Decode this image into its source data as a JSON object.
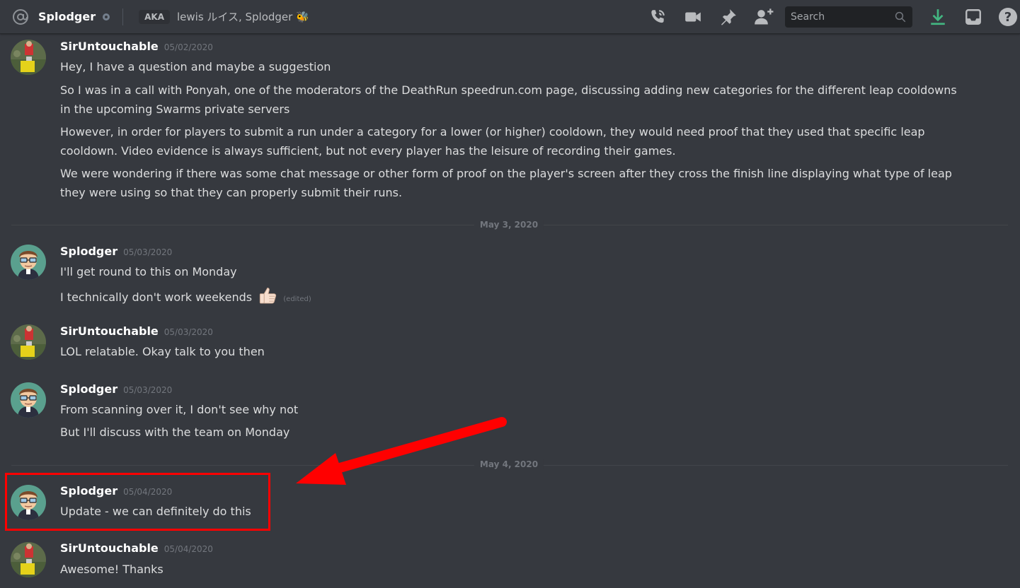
{
  "header": {
    "dm_name": "Splodger",
    "aka_label": "AKA",
    "aka_names": "lewis ルイス, Splodger 🐝",
    "search_placeholder": "Search"
  },
  "users": {
    "sir": "SirUntouchable",
    "splodger": "Splodger"
  },
  "messages": [
    {
      "author": "SirUntouchable",
      "time": "05/02/2020",
      "lines": [
        "Hey, I have a question and maybe a suggestion",
        "So I was in a call with Ponyah, one of the moderators of the DeathRun speedrun.com page, discussing adding new categories for the different leap cooldowns in the upcoming Swarms private servers",
        "However, in order for players to submit a run under a category for a lower (or higher) cooldown, they would need proof that they used that specific leap cooldown.  Video evidence is always sufficient, but not every player has the leisure of recording their games.",
        "We were wondering if there was some chat message or other form of proof on the player's screen after they cross the finish line displaying what type of leap they were using so that they can properly submit their runs."
      ]
    },
    {
      "author": "Splodger",
      "time": "05/03/2020",
      "lines": [
        "I'll get round to this on Monday",
        "I technically don't work weekends"
      ],
      "edited": "(edited)"
    },
    {
      "author": "SirUntouchable",
      "time": "05/03/2020",
      "lines": [
        "LOL relatable. Okay talk to you then"
      ]
    },
    {
      "author": "Splodger",
      "time": "05/03/2020",
      "lines": [
        "From scanning over it, I don't see why not",
        "But I'll discuss with the team on Monday"
      ]
    },
    {
      "author": "Splodger",
      "time": "05/04/2020",
      "lines": [
        "Update - we can definitely do this"
      ]
    },
    {
      "author": "SirUntouchable",
      "time": "05/04/2020",
      "lines": [
        "Awesome! Thanks"
      ]
    }
  ],
  "dividers": [
    "May 3, 2020",
    "May 4, 2020"
  ],
  "colors": {
    "background": "#36393f",
    "highlight": "#ff0000",
    "download": "#43b581"
  }
}
